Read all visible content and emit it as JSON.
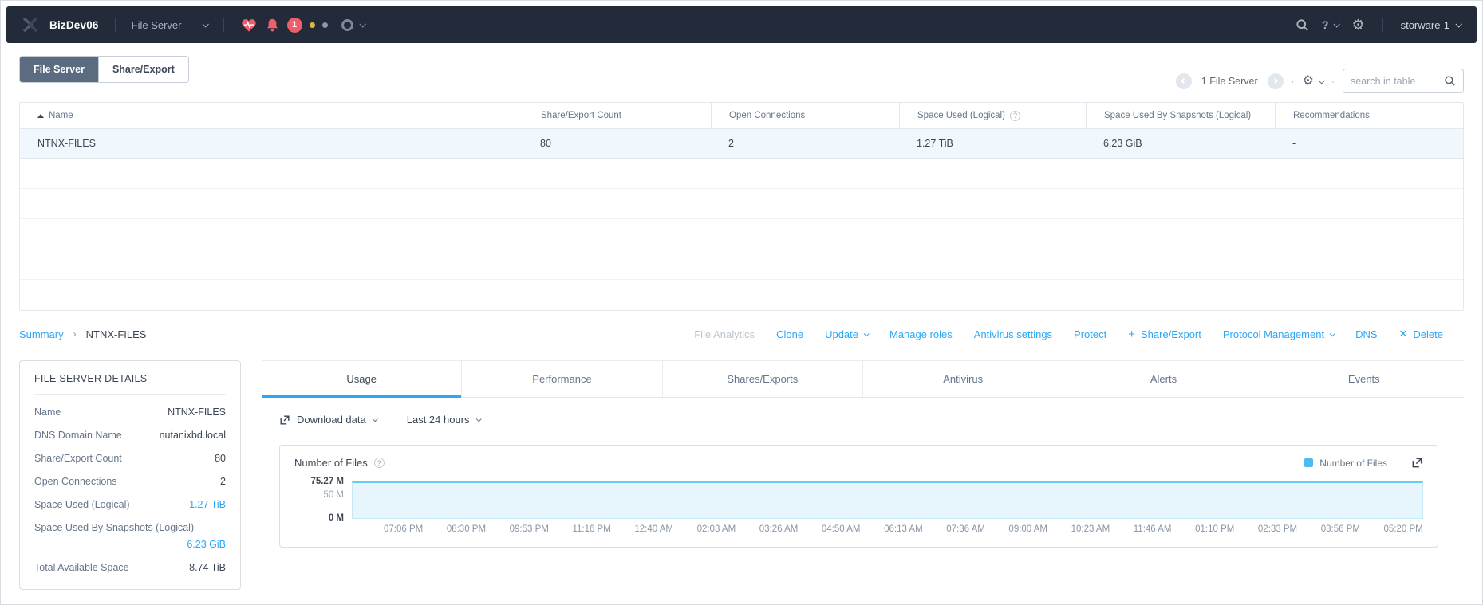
{
  "navbar": {
    "cluster": "BizDev06",
    "context": "File Server",
    "alert_count": "1",
    "help": "?",
    "user": "storware-1"
  },
  "list_header": {
    "tab_file_server": "File Server",
    "tab_share_export": "Share/Export",
    "count_text": "1 File Server",
    "search_placeholder": "search in table"
  },
  "table": {
    "columns": [
      "Name",
      "Share/Export Count",
      "Open Connections",
      "Space Used (Logical)",
      "Space Used By Snapshots (Logical)",
      "Recommendations"
    ],
    "row": [
      "NTNX-FILES",
      "80",
      "2",
      "1.27 TiB",
      "6.23 GiB",
      "-"
    ]
  },
  "breadcrumb": {
    "parent": "Summary",
    "current": "NTNX-FILES"
  },
  "actions": {
    "file_analytics": "File Analytics",
    "clone": "Clone",
    "update": "Update",
    "manage_roles": "Manage roles",
    "antivirus_settings": "Antivirus settings",
    "protect": "Protect",
    "share_export": "Share/Export",
    "protocol_management": "Protocol Management",
    "dns": "DNS",
    "delete": "Delete"
  },
  "details": {
    "title": "FILE SERVER DETAILS",
    "rows": [
      {
        "label": "Name",
        "value": "NTNX-FILES"
      },
      {
        "label": "DNS Domain Name",
        "value": "nutanixbd.local"
      },
      {
        "label": "Share/Export Count",
        "value": "80"
      },
      {
        "label": "Open Connections",
        "value": "2"
      },
      {
        "label": "Space Used (Logical)",
        "value": "1.27 TiB"
      },
      {
        "label": "Space Used By Snapshots (Logical)",
        "value": "6.23 GiB"
      },
      {
        "label": "Total Available Space",
        "value": "8.74 TiB"
      }
    ]
  },
  "detail_tabs": [
    "Usage",
    "Performance",
    "Shares/Exports",
    "Antivirus",
    "Alerts",
    "Events"
  ],
  "usage_toolbar": {
    "download": "Download data",
    "range": "Last 24 hours"
  },
  "chart_data": {
    "type": "area",
    "title": "Number of Files",
    "legend": [
      {
        "label": "Number of Files",
        "color": "#4dbcec"
      }
    ],
    "y_ticks": [
      "75.27 M",
      "50 M",
      "0 M"
    ],
    "ylim": [
      0,
      75270000
    ],
    "grid": false,
    "legend_position": "top-right",
    "x": [
      "07:06 PM",
      "08:30 PM",
      "09:53 PM",
      "11:16 PM",
      "12:40 AM",
      "02:03 AM",
      "03:26 AM",
      "04:50 AM",
      "06:13 AM",
      "07:36 AM",
      "09:00 AM",
      "10:23 AM",
      "11:46 AM",
      "01:10 PM",
      "02:33 PM",
      "03:56 PM",
      "05:20 PM"
    ],
    "series": [
      {
        "name": "Number of Files",
        "values": [
          75270000,
          75270000,
          75270000,
          75270000,
          75270000,
          75270000,
          75270000,
          75270000,
          75270000,
          75270000,
          75270000,
          75270000,
          75270000,
          75270000,
          75270000,
          75270000,
          75270000
        ]
      }
    ],
    "colors": {
      "line": "#6cc9f1",
      "fill": "#e7f5fc"
    }
  }
}
